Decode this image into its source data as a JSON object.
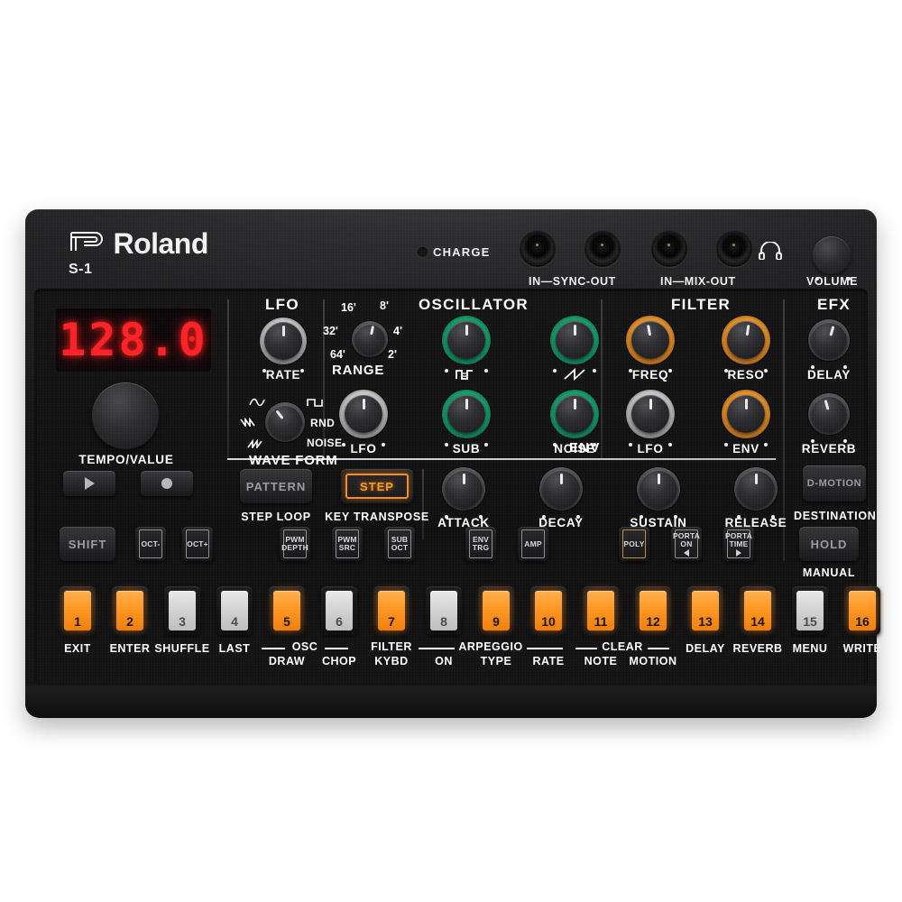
{
  "device": {
    "brand": "Roland",
    "model": "S-1",
    "charge_label": "CHARGE",
    "jack_labels": [
      "IN—SYNC-OUT",
      "IN—MIX-OUT"
    ],
    "headphone_icon": "headphone-icon",
    "volume_label": "VOLUME"
  },
  "display": {
    "value": "128.0",
    "encoder_label": "TEMPO/VALUE"
  },
  "transport": {
    "play": "play-icon",
    "record": "record-icon"
  },
  "sections": {
    "lfo": "LFO",
    "oscillator": "OSCILLATOR",
    "filter": "FILTER",
    "efx": "EFX",
    "env": "ENV"
  },
  "lfo": {
    "rate_label": "RATE",
    "waveform_label": "WAVE FORM",
    "waveform_options": [
      "sine-icon",
      "square-icon",
      "saw-down-icon",
      "RND",
      "saw-up-icon",
      "NOISE"
    ]
  },
  "oscillator": {
    "range_label": "RANGE",
    "range_marks": [
      "16'",
      "8'",
      "32'",
      "4'",
      "64'",
      "2'"
    ],
    "knobs": [
      {
        "label": "",
        "icon": "pulse-width-icon",
        "ring": "green"
      },
      {
        "label": "",
        "icon": "sawtooth-icon",
        "ring": "green"
      },
      {
        "label": "LFO",
        "icon": "",
        "ring": "silver"
      },
      {
        "label": "SUB",
        "icon": "",
        "ring": "green"
      },
      {
        "label": "NOISE",
        "icon": "",
        "ring": "green"
      }
    ]
  },
  "filter": {
    "knobs": [
      {
        "label": "FREQ",
        "ring": "orange"
      },
      {
        "label": "RESO",
        "ring": "orange"
      },
      {
        "label": "LFO",
        "ring": "silver"
      },
      {
        "label": "ENV",
        "ring": "orange"
      }
    ]
  },
  "efx": {
    "knobs": [
      {
        "label": "DELAY",
        "ring": "dark"
      },
      {
        "label": "REVERB",
        "ring": "dark"
      }
    ]
  },
  "env": {
    "knobs": [
      {
        "label": "ATTACK"
      },
      {
        "label": "DECAY"
      },
      {
        "label": "SUSTAIN"
      },
      {
        "label": "RELEASE"
      }
    ]
  },
  "mode_buttons": [
    {
      "label": "PATTERN",
      "sub": "STEP LOOP",
      "lit": false
    },
    {
      "label": "STEP",
      "sub": "KEY TRANSPOSE",
      "lit": true
    }
  ],
  "dmotion": {
    "label": "D-MOTION",
    "sub": "DESTINATION"
  },
  "function_row": {
    "shift": "SHIFT",
    "hold": "HOLD",
    "hold_sub": "MANUAL",
    "buttons": [
      {
        "lines": [
          "OCT-"
        ],
        "arrow": "",
        "amber": false
      },
      {
        "lines": [
          "OCT+"
        ],
        "arrow": "",
        "amber": false
      },
      {
        "lines": [
          "PWM",
          "DEPTH"
        ],
        "arrow": "",
        "amber": false
      },
      {
        "lines": [
          "PWM",
          "SRC"
        ],
        "arrow": "",
        "amber": false
      },
      {
        "lines": [
          "SUB",
          "OCT"
        ],
        "arrow": "",
        "amber": false
      },
      {
        "lines": [
          "ENV",
          "TRG"
        ],
        "arrow": "",
        "amber": false
      },
      {
        "lines": [
          "AMP"
        ],
        "arrow": "",
        "amber": false
      },
      {
        "lines": [
          "POLY"
        ],
        "arrow": "",
        "amber": true
      },
      {
        "lines": [
          "PORTA",
          "ON"
        ],
        "arrow": "left",
        "amber": false
      },
      {
        "lines": [
          "PORTA",
          "TIME"
        ],
        "arrow": "right",
        "amber": false
      }
    ]
  },
  "steps": [
    {
      "num": "1",
      "on": true,
      "label": "EXIT"
    },
    {
      "num": "2",
      "on": true,
      "label": "ENTER"
    },
    {
      "num": "3",
      "on": false,
      "label": "SHUFFLE"
    },
    {
      "num": "4",
      "on": false,
      "label": "LAST"
    },
    {
      "num": "5",
      "on": true,
      "label": "DRAW"
    },
    {
      "num": "6",
      "on": false,
      "label": "CHOP"
    },
    {
      "num": "7",
      "on": true,
      "label": "FILTER\nKYBD"
    },
    {
      "num": "8",
      "on": false,
      "label": "ON"
    },
    {
      "num": "9",
      "on": true,
      "label": "TYPE"
    },
    {
      "num": "10",
      "on": true,
      "label": "RATE"
    },
    {
      "num": "11",
      "on": true,
      "label": "NOTE"
    },
    {
      "num": "12",
      "on": true,
      "label": "MOTION"
    },
    {
      "num": "13",
      "on": true,
      "label": "DELAY"
    },
    {
      "num": "14",
      "on": true,
      "label": "REVERB"
    },
    {
      "num": "15",
      "on": false,
      "label": "MENU"
    },
    {
      "num": "16",
      "on": true,
      "label": "WRITE"
    }
  ],
  "step_groups": [
    {
      "label": "OSC"
    },
    {
      "label": "ARPEGGIO"
    },
    {
      "label": "CLEAR"
    }
  ],
  "step_group_extra": {
    "filter_kybd_line1": "FILTER",
    "filter_kybd_line2": "KYBD"
  },
  "colors": {
    "orange": "#ff9620",
    "green": "#17a06e",
    "amber": "#e8942a",
    "led_red": "#ff1f22",
    "panel": "#0d0d0e"
  }
}
